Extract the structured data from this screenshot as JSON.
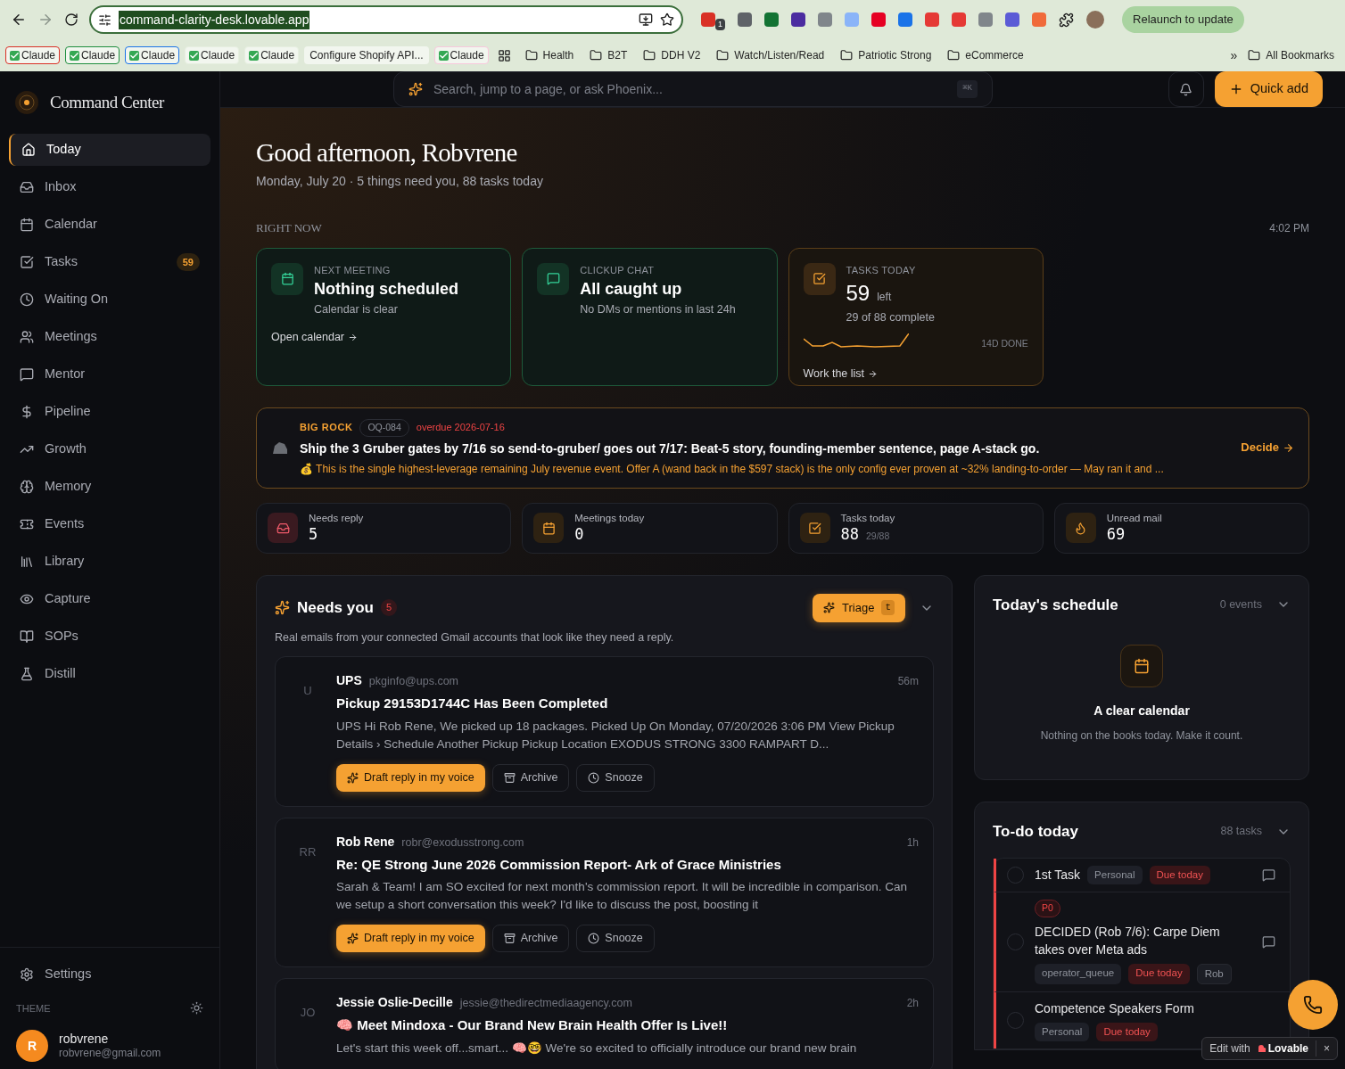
{
  "browser": {
    "url": "command-clarity-desk.lovable.app",
    "extension_badge": "1",
    "relaunch": "Relaunch to update",
    "bookmarks": [
      {
        "kind": "claude",
        "label": "Claude",
        "color": "#d93025"
      },
      {
        "kind": "claude",
        "label": "Claude",
        "color": "#1e8e3e"
      },
      {
        "kind": "claude",
        "label": "Claude",
        "color": "#1a73e8"
      },
      {
        "kind": "claude",
        "label": "Claude",
        "color": "#e6efe0"
      },
      {
        "kind": "claude",
        "label": "Claude",
        "color": "#e6efe0"
      },
      {
        "kind": "plain",
        "label": "Configure Shopify API..."
      },
      {
        "kind": "claude",
        "label": "Claude",
        "color": "#f8c8dc"
      },
      {
        "kind": "apps"
      },
      {
        "kind": "folder",
        "label": "Health"
      },
      {
        "kind": "folder",
        "label": "B2T"
      },
      {
        "kind": "folder",
        "label": "DDH V2"
      },
      {
        "kind": "folder",
        "label": "Watch/Listen/Read"
      },
      {
        "kind": "folder",
        "label": "Patriotic Strong"
      },
      {
        "kind": "folder",
        "label": "eCommerce"
      }
    ],
    "more": "»",
    "all_bookmarks": "All Bookmarks"
  },
  "sidebar": {
    "brand": "Command Center",
    "items": [
      {
        "label": "Today",
        "selected": true
      },
      {
        "label": "Inbox",
        "selected": false
      },
      {
        "label": "Calendar",
        "selected": false
      },
      {
        "label": "Tasks",
        "selected": false,
        "badge": "59"
      },
      {
        "label": "Waiting On",
        "selected": false
      },
      {
        "label": "Meetings",
        "selected": false
      },
      {
        "label": "Mentor",
        "selected": false
      },
      {
        "label": "Pipeline",
        "selected": false
      },
      {
        "label": "Growth",
        "selected": false
      },
      {
        "label": "Memory",
        "selected": false
      },
      {
        "label": "Events",
        "selected": false
      },
      {
        "label": "Library",
        "selected": false
      },
      {
        "label": "Capture",
        "selected": false
      },
      {
        "label": "SOPs",
        "selected": false
      },
      {
        "label": "Distill",
        "selected": false
      }
    ],
    "settings": "Settings",
    "theme_label": "THEME",
    "user": {
      "initial": "R",
      "name": "robvrene",
      "email": "robvrene@gmail.com"
    }
  },
  "header": {
    "search_placeholder": "Search, jump to a page, or ask Phoenix...",
    "shortcut": "⌘K",
    "quick_add": "Quick add"
  },
  "greeting": {
    "title": "Good afternoon, Robvrene",
    "subtitle": "Monday, July 20 · 5 things need you, 88 tasks today"
  },
  "right_now": {
    "label": "RIGHT NOW",
    "time": "4:02 PM",
    "cards": [
      {
        "kind": "meeting",
        "label": "NEXT MEETING",
        "title": "Nothing scheduled",
        "subtitle": "Calendar is clear",
        "link": "Open calendar"
      },
      {
        "kind": "chat",
        "label": "CLICKUP CHAT",
        "title": "All caught up",
        "subtitle": "No DMs or mentions in last 24h"
      },
      {
        "kind": "tasks",
        "label": "TASKS TODAY",
        "value": "59",
        "unit": "left",
        "subtitle": "29 of 88 complete",
        "chart_label": "14D DONE",
        "link": "Work the list"
      }
    ]
  },
  "big_rock": {
    "label": "BIG ROCK",
    "id": "OQ-084",
    "due": "overdue 2026-07-16",
    "title": "Ship the 3 Gruber gates by 7/16 so send-to-gruber/ goes out 7/17: Beat-5 story, founding-member sentence, page A-stack go.",
    "note": "💰 This is the single highest-leverage remaining July revenue event. Offer A (wand back in the $597 stack) is the only config ever proven at ~32% landing-to-order — May ran it and ...",
    "action": "Decide"
  },
  "stats": [
    {
      "label": "Needs reply",
      "value": "5"
    },
    {
      "label": "Meetings today",
      "value": "0"
    },
    {
      "label": "Tasks today",
      "value": "88",
      "sub": "29/88"
    },
    {
      "label": "Unread mail",
      "value": "69"
    }
  ],
  "needs_you": {
    "title": "Needs you",
    "count": "5",
    "triage": "Triage",
    "triage_key": "t",
    "description": "Real emails from your connected Gmail accounts that look like they need a reply.",
    "emails": [
      {
        "initials": "U",
        "sender": "UPS",
        "email": "pkginfo@ups.com",
        "time": "56m",
        "subject": "Pickup 29153D1744C Has Been Completed",
        "body": "UPS Hi Rob Rene, We picked up 18 packages. Picked Up On Monday, 07/20/2026 3:06 PM View Pickup Details › Schedule Another Pickup Pickup Location EXODUS STRONG 3300 RAMPART D...",
        "actions": [
          "Draft reply in my voice",
          "Archive",
          "Snooze"
        ]
      },
      {
        "initials": "RR",
        "sender": "Rob Rene",
        "email": "robr@exodusstrong.com",
        "time": "1h",
        "subject": "Re: QE Strong June 2026 Commission Report- Ark of Grace Ministries",
        "body": "Sarah & Team! I am SO excited for next month's commission report. It will be incredible in comparison. Can we setup a short conversation this week? I'd like to discuss the post, boosting it",
        "actions": [
          "Draft reply in my voice",
          "Archive",
          "Snooze"
        ]
      },
      {
        "initials": "JO",
        "sender": "Jessie Oslie-Decille",
        "email": "jessie@thedirectmediaagency.com",
        "time": "2h",
        "subject": "🧠 Meet Mindoxa - Our Brand New Brain Health Offer Is Live!!",
        "body": "Let's start this week off...smart... 🧠🤓 We're so excited to officially introduce our brand new brain"
      }
    ]
  },
  "schedule": {
    "title": "Today's schedule",
    "count": "0 events",
    "empty_title": "A clear calendar",
    "empty_text": "Nothing on the books today. Make it count."
  },
  "todo": {
    "title": "To-do today",
    "count": "88 tasks",
    "tasks": [
      {
        "checked": false,
        "title": "1st Task",
        "tags": [
          {
            "kind": "plain",
            "label": "Personal"
          },
          {
            "kind": "due",
            "label": "Due today"
          }
        ]
      },
      {
        "checked": false,
        "priority": "P0",
        "title": "DECIDED (Rob 7/6): Carpe Diem takes over Meta ads",
        "tags": [
          {
            "kind": "plain",
            "label": "operator_queue"
          },
          {
            "kind": "due",
            "label": "Due today"
          },
          {
            "kind": "person",
            "label": "Rob"
          }
        ]
      },
      {
        "checked": false,
        "title": "Competence Speakers Form",
        "tags": [
          {
            "kind": "plain",
            "label": "Personal"
          },
          {
            "kind": "due",
            "label": "Due today"
          }
        ]
      }
    ]
  },
  "lovable": {
    "prefix": "Edit with",
    "brand": "Lovable",
    "close": "×"
  }
}
